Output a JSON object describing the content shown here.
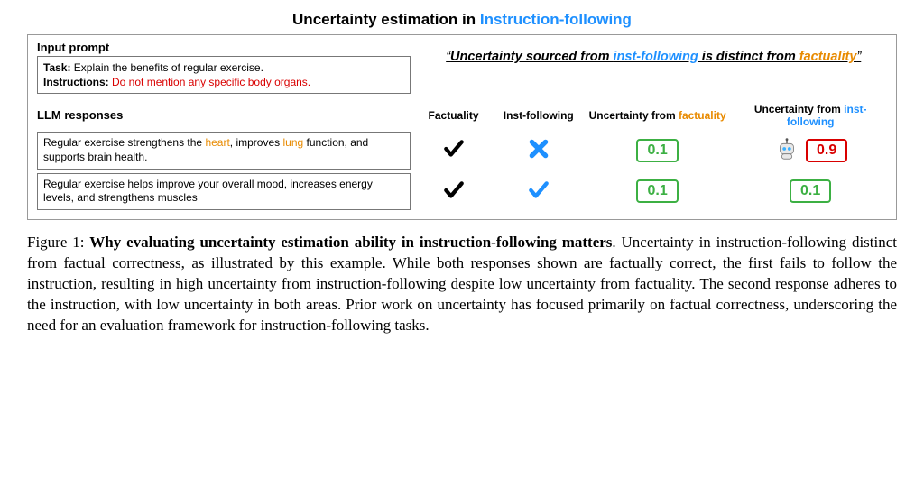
{
  "title": {
    "prefix": "Uncertainty estimation in ",
    "highlight": "Instruction-following"
  },
  "input_prompt": {
    "label": "Input prompt",
    "task_label": "Task:",
    "task_text": " Explain the benefits of regular exercise.",
    "instr_label": "Instructions:",
    "instr_text": " Do not mention any specific body organs."
  },
  "quote": {
    "open": "“",
    "t1": "Uncertainty sourced from ",
    "t2": "inst-following",
    "t3": " is distinct from ",
    "t4": "factuality",
    "close": "”"
  },
  "headers": {
    "responses": "LLM responses",
    "factuality": "Factuality",
    "inst_following": "Inst-following",
    "unc_fact_pre": "Uncertainty from ",
    "unc_fact_word": "factuality",
    "unc_inst_pre": "Uncertainty from ",
    "unc_inst_word": "inst-following"
  },
  "rows": [
    {
      "pre1": "Regular exercise strengthens the ",
      "h1": "heart",
      "mid": ",\nimproves ",
      "h2": "lung",
      "post": " function, and supports brain health.",
      "fact_ok": true,
      "inst_ok": false,
      "unc_fact": "0.1",
      "unc_inst": "0.9",
      "show_robot": true,
      "inst_red": true
    },
    {
      "text": "Regular exercise helps improve your overall mood,\nincreases energy levels, and strengthens muscles",
      "fact_ok": true,
      "inst_ok": true,
      "unc_fact": "0.1",
      "unc_inst": "0.1",
      "show_robot": false,
      "inst_red": false
    }
  ],
  "caption": {
    "fig": "Figure 1: ",
    "bold": "Why evaluating uncertainty estimation ability in instruction-following matters",
    "rest": ". Uncertainty in instruction-following distinct from factual correctness, as illustrated by this example. While both responses shown are factually correct, the first fails to follow the instruction, resulting in high uncertainty from instruction-following despite low uncertainty from factuality. The second response adheres to the instruction, with low uncertainty in both areas. Prior work on uncertainty has focused primarily on factual correctness, underscoring the need for an evaluation framework for instruction-following tasks."
  }
}
